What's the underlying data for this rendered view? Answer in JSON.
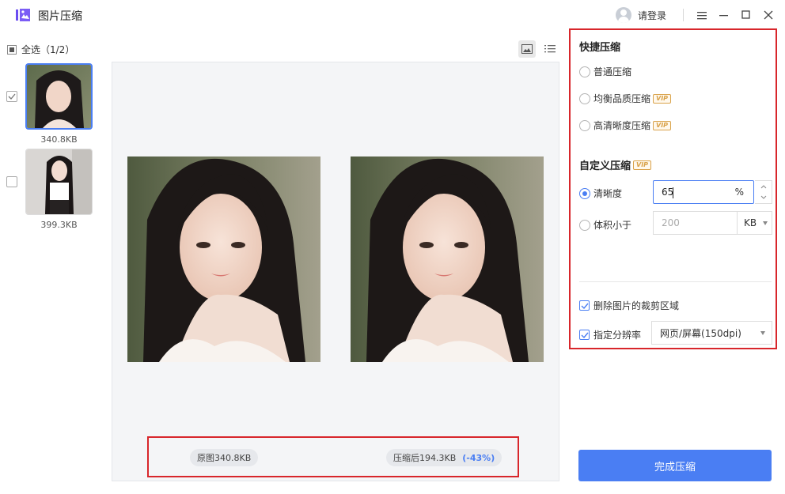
{
  "app": {
    "title": "图片压缩",
    "login_label": "请登录"
  },
  "left": {
    "select_all_label": "全选（1/2）",
    "items": [
      {
        "size": "340.8KB",
        "checked": true,
        "selected": true
      },
      {
        "size": "399.3KB",
        "checked": false,
        "selected": false
      }
    ]
  },
  "preview": {
    "original_label": "原图340.8KB",
    "compressed_label": "压缩后194.3KB",
    "reduction": "(-43%)"
  },
  "settings": {
    "quick_title": "快捷压缩",
    "quick_options": [
      "普通压缩",
      "均衡品质压缩",
      "高清晰度压缩"
    ],
    "vip_label": "VIP",
    "custom_title": "自定义压缩",
    "clarity_label": "清晰度",
    "clarity_value": "65",
    "clarity_unit": "%",
    "size_label": "体积小于",
    "size_placeholder": "200",
    "size_unit": "KB",
    "remove_crop_label": "删除图片的裁剪区域",
    "resolution_label": "指定分辨率",
    "resolution_value": "网页/屏幕(150dpi)"
  },
  "actions": {
    "complete_label": "完成压缩"
  },
  "colors": {
    "accent": "#4a7ef3",
    "highlight": "#d8262b",
    "vip": "#d9a24a"
  }
}
